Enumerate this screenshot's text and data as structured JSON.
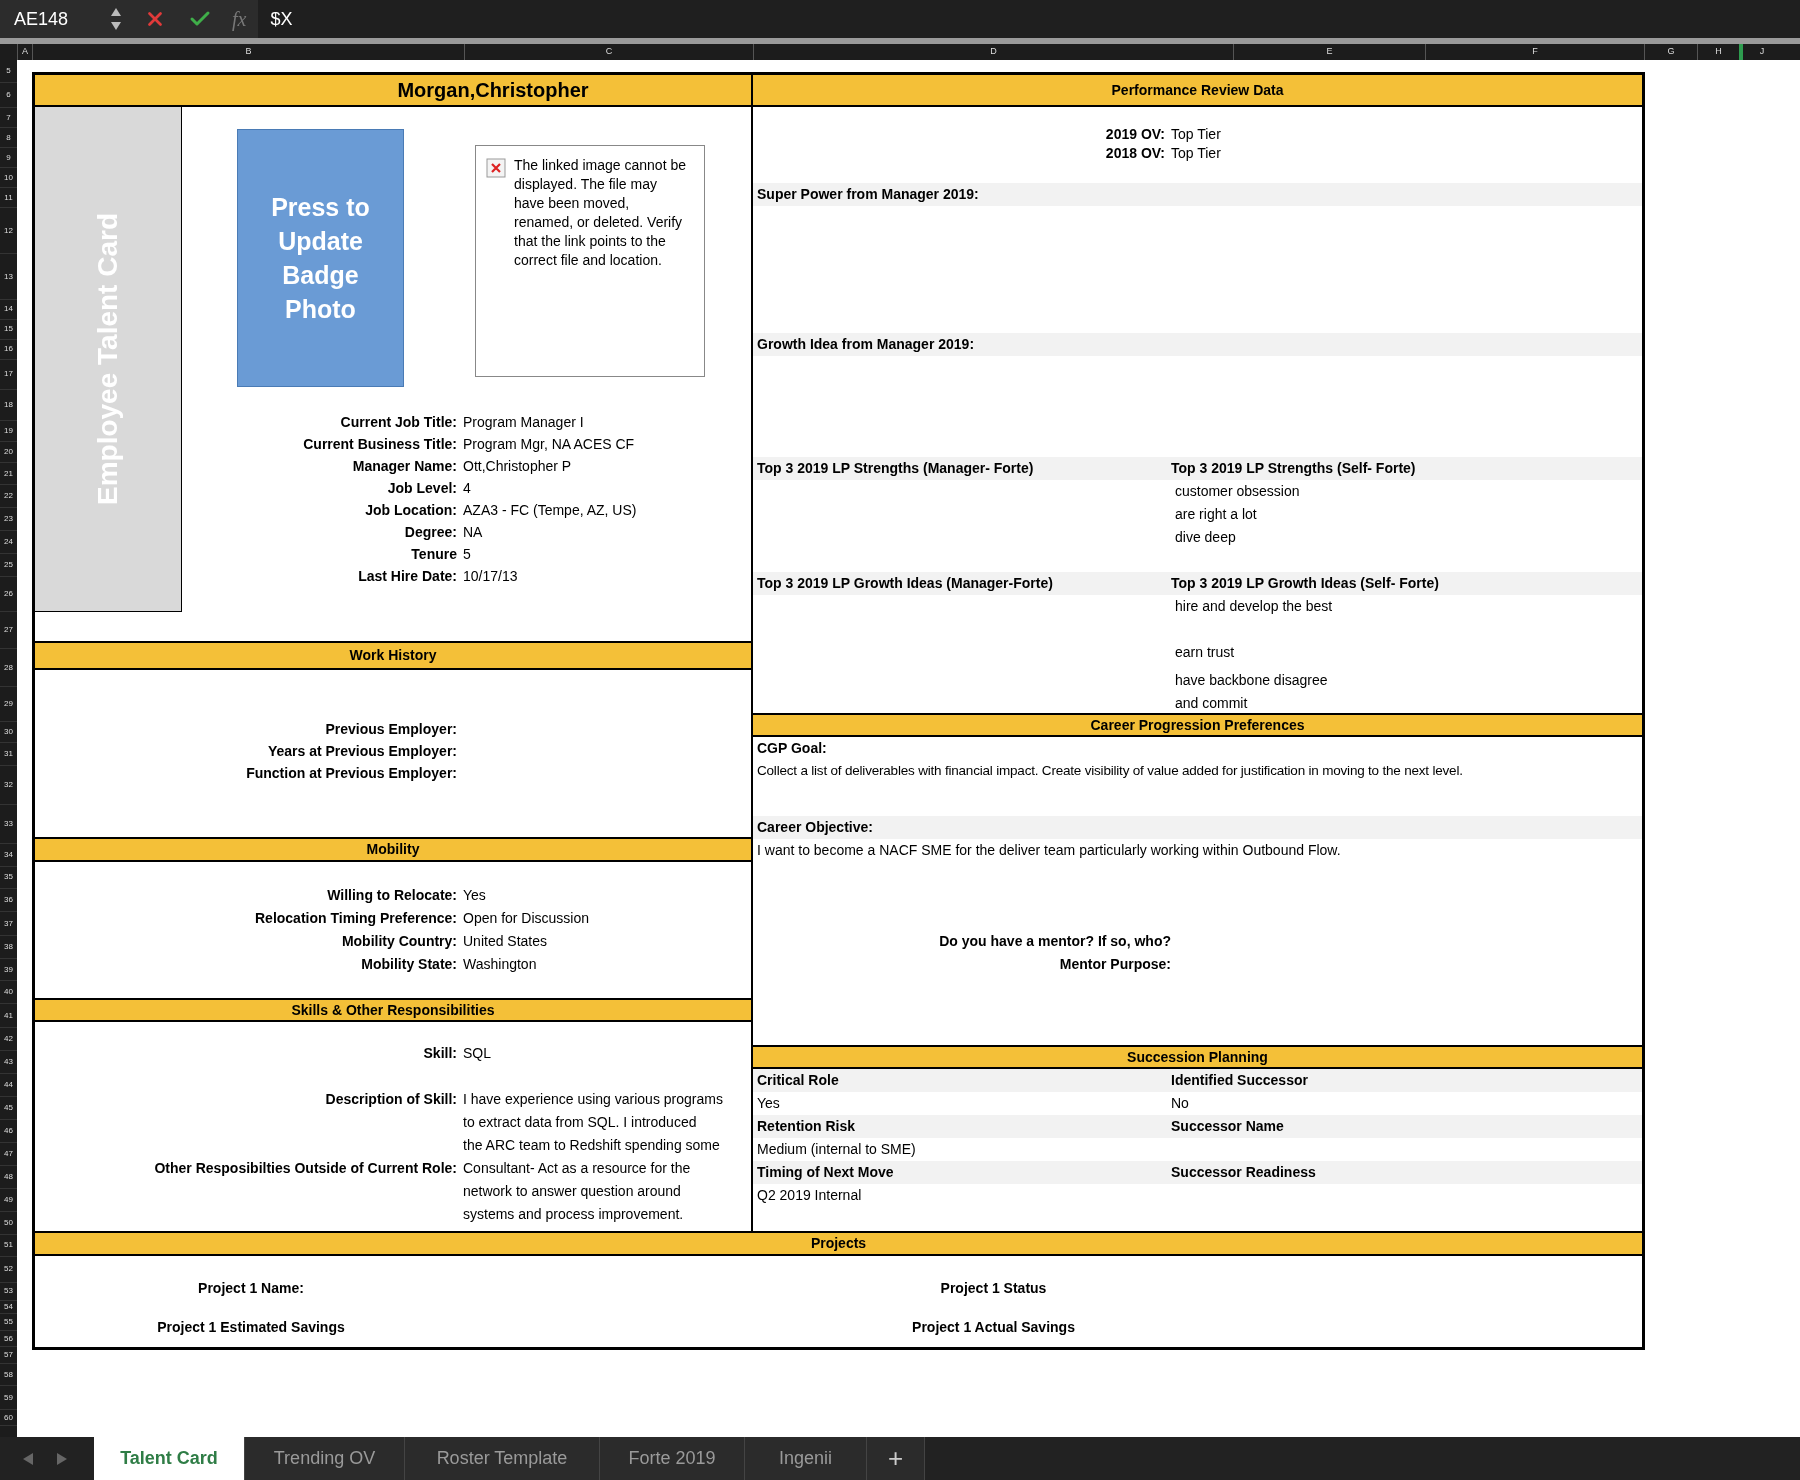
{
  "formula_bar": {
    "cell_reference": "AE148",
    "function_symbol": "fx",
    "formula": "$X"
  },
  "column_headers": [
    "A",
    "B",
    "C",
    "D",
    "E",
    "F",
    "G",
    "H",
    "J"
  ],
  "row_headers": [
    "5",
    "6",
    "7",
    "8",
    "9",
    "10",
    "11",
    "12",
    "13",
    "14",
    "15",
    "16",
    "17",
    "18",
    "19",
    "20",
    "21",
    "22",
    "23",
    "24",
    "25",
    "26",
    "27",
    "28",
    "29",
    "30",
    "31",
    "32",
    "33",
    "34",
    "35",
    "36",
    "37",
    "38",
    "39",
    "40",
    "41",
    "42",
    "43",
    "44",
    "45",
    "46",
    "47",
    "48",
    "49",
    "50",
    "51",
    "52",
    "53",
    "54",
    "55",
    "56",
    "57",
    "58",
    "59",
    "60"
  ],
  "card": {
    "employee_name": "Morgan,Christopher",
    "side_banner": "Employee Talent Card",
    "badge_button": "Press to Update Badge Photo",
    "broken_image_message": "The linked image cannot be displayed.  The file may have been moved, renamed, or deleted.  Verify that the link points to the correct file and location.",
    "profile": [
      {
        "label": "Current Job Title:",
        "value": "Program Manager I"
      },
      {
        "label": "Current Business Title:",
        "value": "Program Mgr, NA ACES CF"
      },
      {
        "label": "Manager Name:",
        "value": "Ott,Christopher P"
      },
      {
        "label": "Job Level:",
        "value": "4"
      },
      {
        "label": "Job Location:",
        "value": "AZA3 - FC (Tempe, AZ, US)"
      },
      {
        "label": "Degree:",
        "value": "NA"
      },
      {
        "label": "Tenure",
        "value": "5"
      },
      {
        "label": "Last Hire Date:",
        "value": "10/17/13"
      }
    ],
    "work_history": {
      "title": "Work History",
      "fields": [
        {
          "label": "Previous Employer:"
        },
        {
          "label": "Years at Previous Employer:"
        },
        {
          "label": "Function at Previous Employer:"
        }
      ]
    },
    "mobility": {
      "title": "Mobility",
      "fields": [
        {
          "label": "Willing to Relocate:",
          "value": "Yes"
        },
        {
          "label": "Relocation Timing Preference:",
          "value": "Open for Discussion"
        },
        {
          "label": "Mobility Country:",
          "value": "United States"
        },
        {
          "label": "Mobility State:",
          "value": "Washington"
        }
      ]
    },
    "skills": {
      "title": "Skills & Other Responsibilities",
      "fields": [
        {
          "label": "Skill:",
          "lines": [
            "SQL"
          ]
        },
        {
          "label": "Description of Skill:",
          "lines": [
            "I have experience using various programs",
            "to extract data from SQL. I introduced",
            "the ARC team to Redshift  spending some"
          ]
        },
        {
          "label": "Other Resposibilties Outside of Current Role:",
          "lines": [
            "Consultant- Act as a resource for the",
            "network to answer question around",
            "systems and process improvement."
          ]
        }
      ]
    },
    "performance": {
      "title": "Performance Review Data",
      "ratings": [
        {
          "label": "2019 OV:",
          "value": "Top Tier"
        },
        {
          "label": "2018 OV:",
          "value": "Top Tier"
        }
      ],
      "super_power": "Super Power from Manager 2019:",
      "growth_idea": "Growth Idea from Manager 2019:",
      "strengths": {
        "manager_heading": "Top 3 2019 LP Strengths (Manager- Forte)",
        "self_heading": "Top 3 2019 LP Strengths (Self- Forte)",
        "self_items": [
          [
            "customer obsession"
          ],
          [
            "are right a lot"
          ],
          [
            "dive deep"
          ]
        ]
      },
      "growth_ideas": {
        "manager_heading": "Top 3 2019 LP Growth Ideas (Manager-Forte)",
        "self_heading": "Top 3 2019 LP Growth Ideas (Self- Forte)",
        "self_items": [
          [
            "hire and develop the best"
          ],
          [
            "earn trust"
          ],
          [
            "have backbone disagree",
            "and commit"
          ]
        ]
      }
    },
    "career": {
      "title": "Career Progression Preferences",
      "cgp_goal_label": "CGP Goal:",
      "cgp_goal": "Collect a list of deliverables with financial impact. Create visibility of value added for justification in moving to the next level.",
      "objective_label": "Career Objective:",
      "objective": "I want to become a NACF SME for the deliver team  particularly working within Outbound Flow.",
      "mentor_question": "Do you have a mentor? If so, who?",
      "mentor_purpose": "Mentor Purpose:"
    },
    "succession": {
      "title": "Succession Planning",
      "rows": [
        {
          "left": {
            "label": "Critical Role",
            "value": "Yes"
          },
          "right": {
            "label": "Identified Successor",
            "value": "No"
          }
        },
        {
          "left": {
            "label": "Retention Risk",
            "value": "Medium (internal to SME)"
          },
          "right": {
            "label": "Successor Name"
          }
        },
        {
          "left": {
            "label": "Timing of Next Move",
            "value": "Q2 2019 Internal"
          },
          "right": {
            "label": "Successor Readiness"
          }
        }
      ]
    },
    "projects": {
      "title": "Projects",
      "fields": [
        "Project 1 Name:",
        "Project 1 Status",
        "Project 1 Estimated Savings",
        "Project 1 Actual Savings"
      ]
    }
  },
  "sheet_tabs": [
    {
      "label": "Talent Card",
      "selected": true
    },
    {
      "label": "Trending OV",
      "selected": false
    },
    {
      "label": "Roster Template",
      "selected": false
    },
    {
      "label": "Forte 2019",
      "selected": false
    },
    {
      "label": "Ingenii",
      "selected": false
    }
  ],
  "add_sheet_symbol": "+"
}
